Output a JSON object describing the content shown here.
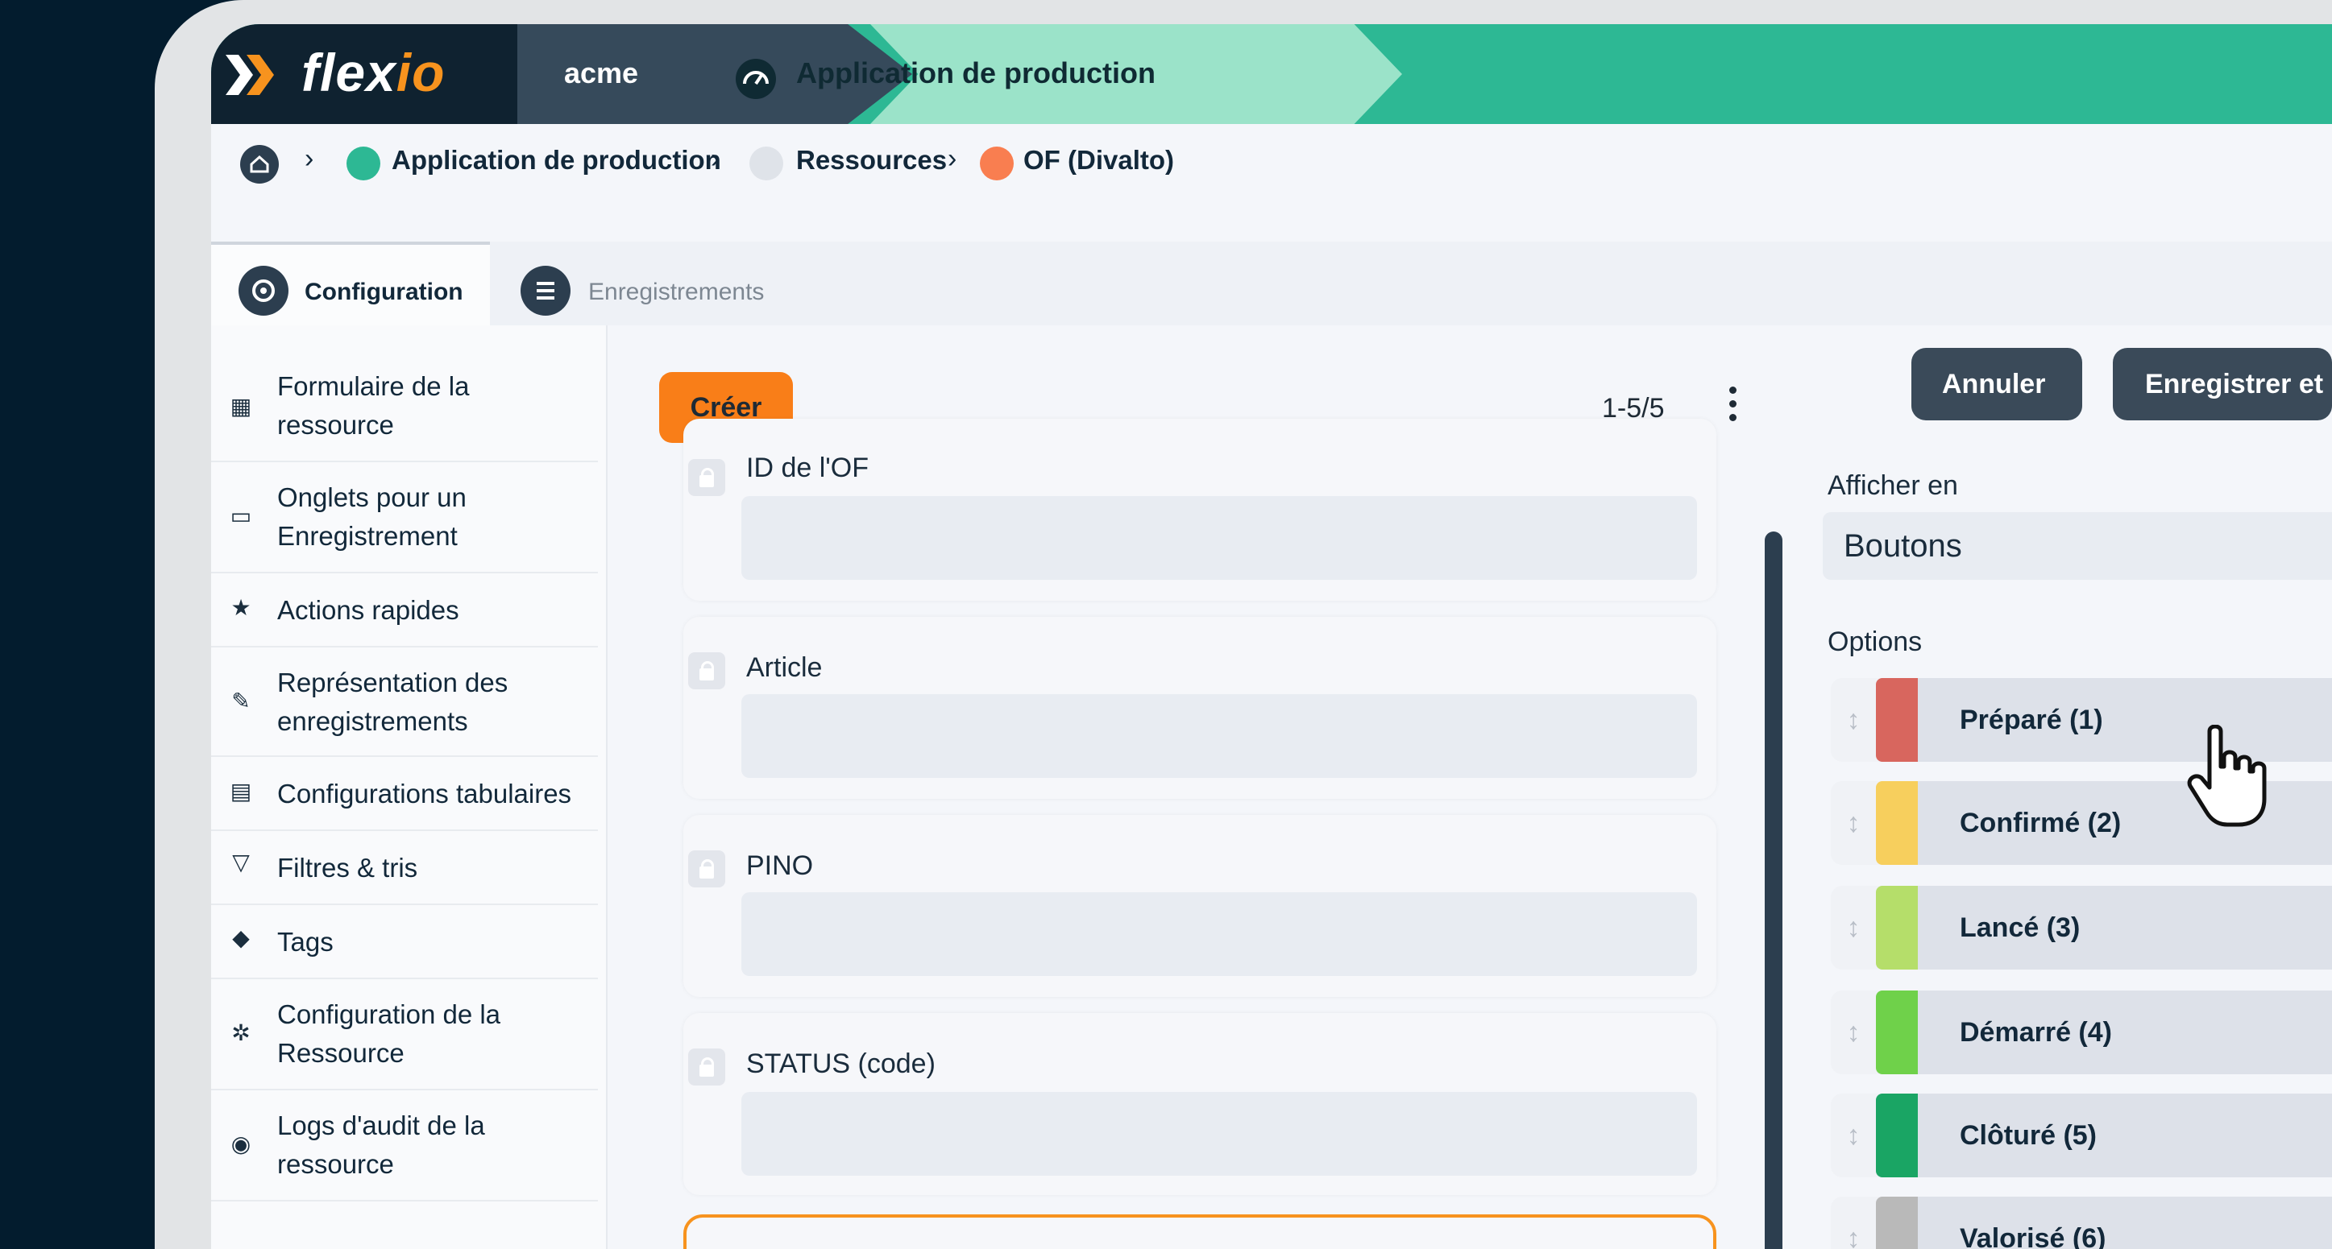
{
  "brand": {
    "logo_prefix": "flex",
    "logo_suffix": "io",
    "workspace": "acme",
    "app_name": "Application de production"
  },
  "breadcrumb": {
    "items": [
      {
        "label": "Application de production",
        "icon": "gauge-icon"
      },
      {
        "label": "Ressources",
        "icon": "stack-icon"
      },
      {
        "label": "OF (Divalto)",
        "icon": "document-icon"
      }
    ]
  },
  "tabs": [
    {
      "label": "Configuration",
      "icon": "gear-icon",
      "active": true
    },
    {
      "label": "Enregistrements",
      "icon": "list-icon",
      "active": false
    }
  ],
  "sidebar": {
    "items": [
      {
        "label": "Formulaire de la ressource",
        "icon": "table-icon"
      },
      {
        "label": "Onglets pour un Enregistrement",
        "icon": "folder-icon"
      },
      {
        "label": "Actions rapides",
        "icon": "star-icon"
      },
      {
        "label": "Représentation des enregistrements",
        "icon": "pencil-icon"
      },
      {
        "label": "Configurations tabulaires",
        "icon": "file-icon"
      },
      {
        "label": "Filtres & tris",
        "icon": "filter-icon"
      },
      {
        "label": "Tags",
        "icon": "tag-icon"
      },
      {
        "label": "Configuration de la Ressource",
        "icon": "cog-icon"
      },
      {
        "label": "Logs d'audit de la ressource",
        "icon": "eye-icon"
      }
    ]
  },
  "middle": {
    "create_label": "Créer",
    "pager": "1-5/5",
    "fields": [
      {
        "label": "ID de l'OF",
        "value": ""
      },
      {
        "label": "Article",
        "value": ""
      },
      {
        "label": "PINO",
        "value": ""
      },
      {
        "label": "STATUS (code)",
        "value": ""
      }
    ]
  },
  "right": {
    "cancel_label": "Annuler",
    "save_label": "Enregistrer et",
    "display_label": "Afficher en",
    "display_value": "Boutons",
    "options_label": "Options",
    "options": [
      {
        "label": "Préparé (1)",
        "color": "#d8665e"
      },
      {
        "label": "Confirmé (2)",
        "color": "#f7cf5d"
      },
      {
        "label": "Lancé (3)",
        "color": "#b5de6a"
      },
      {
        "label": "Démarré (4)",
        "color": "#6fd14a"
      },
      {
        "label": "Clôturé (5)",
        "color": "#1aa564"
      },
      {
        "label": "Valorisé (6)",
        "color": "#b9b9b9"
      }
    ]
  },
  "colors": {
    "accent": "#f97e18",
    "brand_green": "#2db894",
    "dark": "#2c3e4f"
  }
}
